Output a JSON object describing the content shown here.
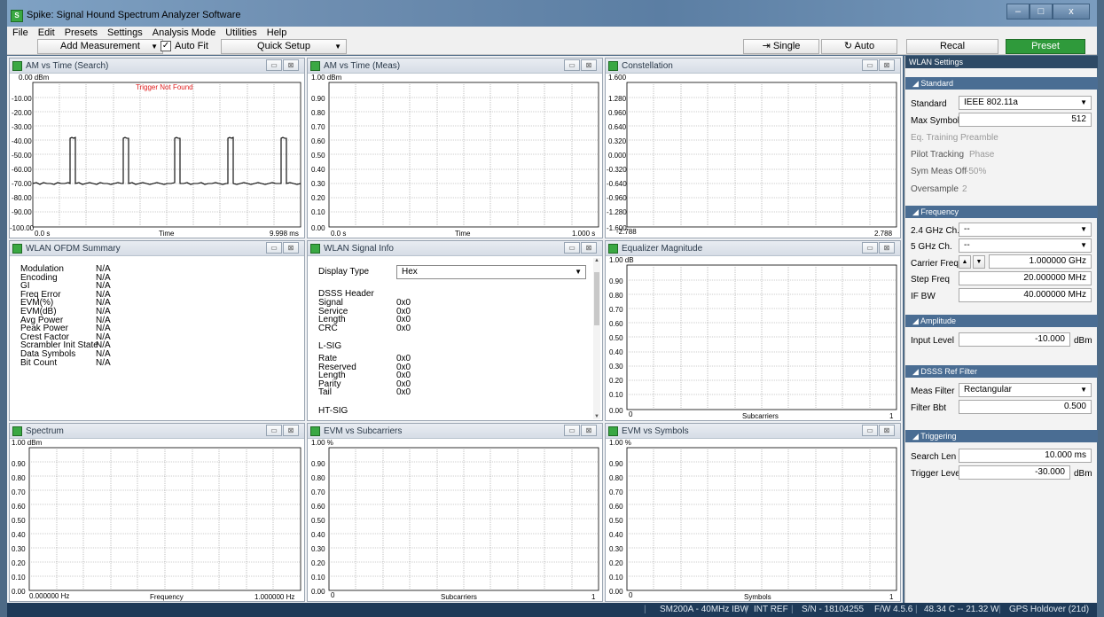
{
  "window": {
    "title": "Spike: Signal Hound Spectrum Analyzer Software"
  },
  "menu": [
    "File",
    "Edit",
    "Presets",
    "Settings",
    "Analysis Mode",
    "Utilities",
    "Help"
  ],
  "toolbar": {
    "add_measurement": "Add Measurement",
    "auto_fit": "Auto Fit",
    "auto_fit_checked": true,
    "quick_setup": "Quick Setup",
    "single": "Single",
    "auto": "Auto",
    "recal": "Recal",
    "preset": "Preset"
  },
  "panels": {
    "am_search": {
      "title": "AM vs Time (Search)",
      "annotation": "Trigger Not Found",
      "y_ticks": [
        "0.00 dBm",
        "-10.00",
        "-20.00",
        "-30.00",
        "-40.00",
        "-50.00",
        "-60.00",
        "-70.00",
        "-80.00",
        "-90.00",
        "-100.00"
      ],
      "x_start": "0.0 s",
      "x_label": "Time",
      "x_end": "9.998 ms"
    },
    "am_meas": {
      "title": "AM vs Time (Meas)",
      "y_ticks": [
        "1.00 dBm",
        "0.90",
        "0.80",
        "0.70",
        "0.60",
        "0.50",
        "0.40",
        "0.30",
        "0.20",
        "0.10",
        "0.00"
      ],
      "x_start": "0.0 s",
      "x_label": "Time",
      "x_end": "1.000 s"
    },
    "constellation": {
      "title": "Constellation",
      "y_ticks": [
        "1.600",
        "1.280",
        "0.960",
        "0.640",
        "0.320",
        "0.000",
        "-0.320",
        "-0.640",
        "-0.960",
        "-1.280",
        "-1.600"
      ],
      "x_start": "-2.788",
      "x_end": "2.788"
    },
    "summary": {
      "title": "WLAN OFDM Summary",
      "rows": [
        {
          "k": "Modulation",
          "v": "N/A"
        },
        {
          "k": "Encoding",
          "v": "N/A"
        },
        {
          "k": "GI",
          "v": "N/A"
        },
        {
          "k": "Freq Error",
          "v": "N/A"
        },
        {
          "k": "EVM(%)",
          "v": "N/A"
        },
        {
          "k": "EVM(dB)",
          "v": "N/A"
        },
        {
          "k": "Avg Power",
          "v": "N/A"
        },
        {
          "k": "Peak Power",
          "v": "N/A"
        },
        {
          "k": "Crest Factor",
          "v": "N/A"
        },
        {
          "k": "Scrambler Init State",
          "v": "N/A"
        },
        {
          "k": "Data Symbols",
          "v": "N/A"
        },
        {
          "k": "Bit Count",
          "v": "N/A"
        }
      ]
    },
    "signal_info": {
      "title": "WLAN Signal Info",
      "display_type_label": "Display Type",
      "display_type_value": "Hex",
      "dsss_header": "DSSS Header",
      "dsss_rows": [
        {
          "k": "Signal",
          "v": "0x0"
        },
        {
          "k": "Service",
          "v": "0x0"
        },
        {
          "k": "Length",
          "v": "0x0"
        },
        {
          "k": "CRC",
          "v": "0x0"
        }
      ],
      "lsig_header": "L-SIG",
      "lsig_rows": [
        {
          "k": "Rate",
          "v": "0x0"
        },
        {
          "k": "Reserved",
          "v": "0x0"
        },
        {
          "k": "Length",
          "v": "0x0"
        },
        {
          "k": "Parity",
          "v": "0x0"
        },
        {
          "k": "Tail",
          "v": "0x0"
        }
      ],
      "htsig_header": "HT-SIG"
    },
    "equalizer": {
      "title": "Equalizer Magnitude",
      "y_ticks": [
        "1.00 dB",
        "0.90",
        "0.80",
        "0.70",
        "0.60",
        "0.50",
        "0.40",
        "0.30",
        "0.20",
        "0.10",
        "0.00"
      ],
      "x_start": "0",
      "x_label": "Subcarriers",
      "x_end": "1"
    },
    "spectrum": {
      "title": "Spectrum",
      "y_ticks": [
        "1.00 dBm",
        "0.90",
        "0.80",
        "0.70",
        "0.60",
        "0.50",
        "0.40",
        "0.30",
        "0.20",
        "0.10",
        "0.00"
      ],
      "x_start": "0.000000 Hz",
      "x_label": "Frequency",
      "x_end": "1.000000 Hz"
    },
    "evm_sub": {
      "title": "EVM vs Subcarriers",
      "y_ticks": [
        "1.00 %",
        "0.90",
        "0.80",
        "0.70",
        "0.60",
        "0.50",
        "0.40",
        "0.30",
        "0.20",
        "0.10",
        "0.00"
      ],
      "x_start": "0",
      "x_label": "Subcarriers",
      "x_end": "1"
    },
    "evm_sym": {
      "title": "EVM vs Symbols",
      "y_ticks": [
        "1.00 %",
        "0.90",
        "0.80",
        "0.70",
        "0.60",
        "0.50",
        "0.40",
        "0.30",
        "0.20",
        "0.10",
        "0.00"
      ],
      "x_start": "0",
      "x_label": "Symbols",
      "x_end": "1"
    }
  },
  "settings": {
    "header": "WLAN Settings",
    "standard_section": "Standard",
    "standard_label": "Standard",
    "standard_value": "IEEE 802.11a",
    "max_symbols_label": "Max Symbols",
    "max_symbols_value": "512",
    "eq_training_label": "Eq. Training",
    "eq_training_value": "Preamble",
    "pilot_tracking_label": "Pilot Tracking",
    "pilot_tracking_value": "Phase",
    "sym_meas_off_label": "Sym Meas Off",
    "sym_meas_off_value": "-50%",
    "oversample_label": "Oversample",
    "oversample_value": "2",
    "frequency_section": "Frequency",
    "ch24_label": "2.4 GHz Ch.",
    "ch24_value": "--",
    "ch5_label": "5 GHz Ch.",
    "ch5_value": "--",
    "carrier_label": "Carrier Freq",
    "carrier_value": "1.000000 GHz",
    "step_label": "Step Freq",
    "step_value": "20.000000 MHz",
    "ifbw_label": "IF BW",
    "ifbw_value": "40.000000 MHz",
    "amplitude_section": "Amplitude",
    "input_level_label": "Input Level",
    "input_level_value": "-10.000",
    "input_level_unit": "dBm",
    "dsss_section": "DSSS Ref Filter",
    "meas_filter_label": "Meas Filter",
    "meas_filter_value": "Rectangular",
    "filter_bbt_label": "Filter Bbt",
    "filter_bbt_value": "0.500",
    "triggering_section": "Triggering",
    "search_len_label": "Search Len",
    "search_len_value": "10.000 ms",
    "trigger_level_label": "Trigger Level",
    "trigger_level_value": "-30.000",
    "trigger_level_unit": "dBm"
  },
  "status": {
    "device": "SM200A - 40MHz IBW",
    "ref": "INT REF",
    "serial": "S/N - 18104255",
    "fw": "F/W 4.5.6",
    "temp": "48.34 C -- 21.32 W",
    "gps": "GPS Holdover (21d)"
  },
  "colors": {
    "preset_green": "#2f9a3b",
    "settings_header": "#2e4a66",
    "section": "#4a6d93",
    "status_bg": "#1e3a58"
  }
}
